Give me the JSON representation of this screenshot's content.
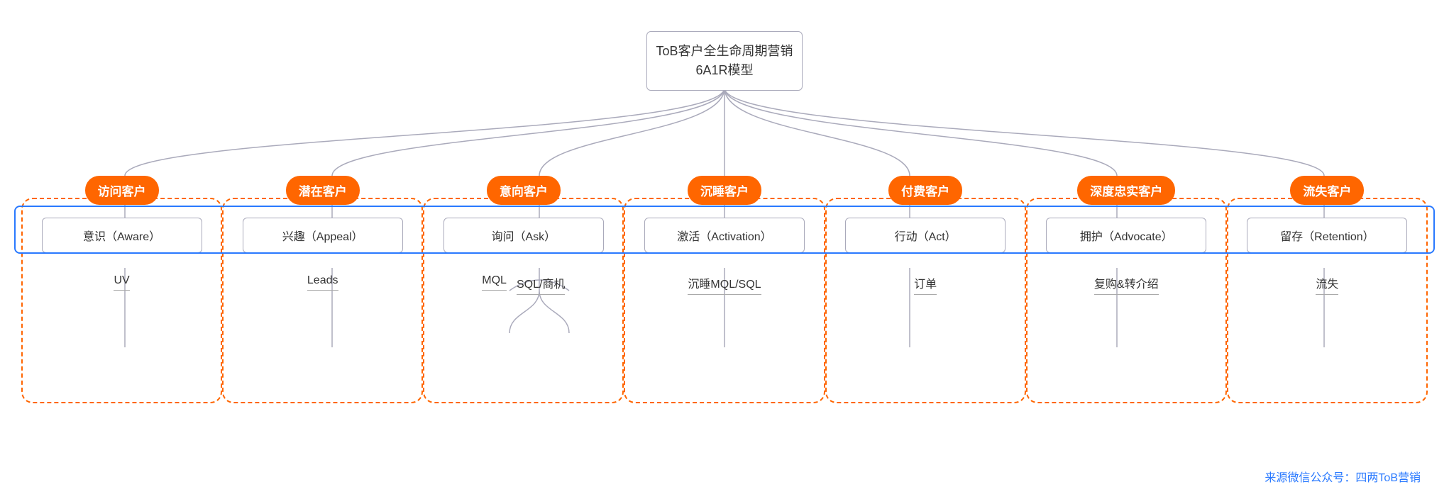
{
  "root": {
    "line1": "ToB客户全生命周期营销",
    "line2": "6A1R模型"
  },
  "columns": [
    {
      "id": "col1",
      "badge": "访问客户",
      "aware": "意识（Aware）",
      "sub_items": [
        "UV"
      ]
    },
    {
      "id": "col2",
      "badge": "潜在客户",
      "aware": "兴趣（Appeal）",
      "sub_items": [
        "Leads"
      ]
    },
    {
      "id": "col3",
      "badge": "意向客户",
      "aware": "询问（Ask）",
      "sub_items": [
        "MQL",
        "SQL/商机"
      ]
    },
    {
      "id": "col4",
      "badge": "沉睡客户",
      "aware": "激活（Activation）",
      "sub_items": [
        "沉睡MQL/SQL"
      ]
    },
    {
      "id": "col5",
      "badge": "付费客户",
      "aware": "行动（Act）",
      "sub_items": [
        "订单"
      ]
    },
    {
      "id": "col6",
      "badge": "深度忠实客户",
      "aware": "拥护（Advocate）",
      "sub_items": [
        "复购&转介绍"
      ]
    },
    {
      "id": "col7",
      "badge": "流失客户",
      "aware": "留存（Retention）",
      "sub_items": [
        "流失"
      ]
    }
  ],
  "source_label": "来源微信公众号：四两ToB营销"
}
